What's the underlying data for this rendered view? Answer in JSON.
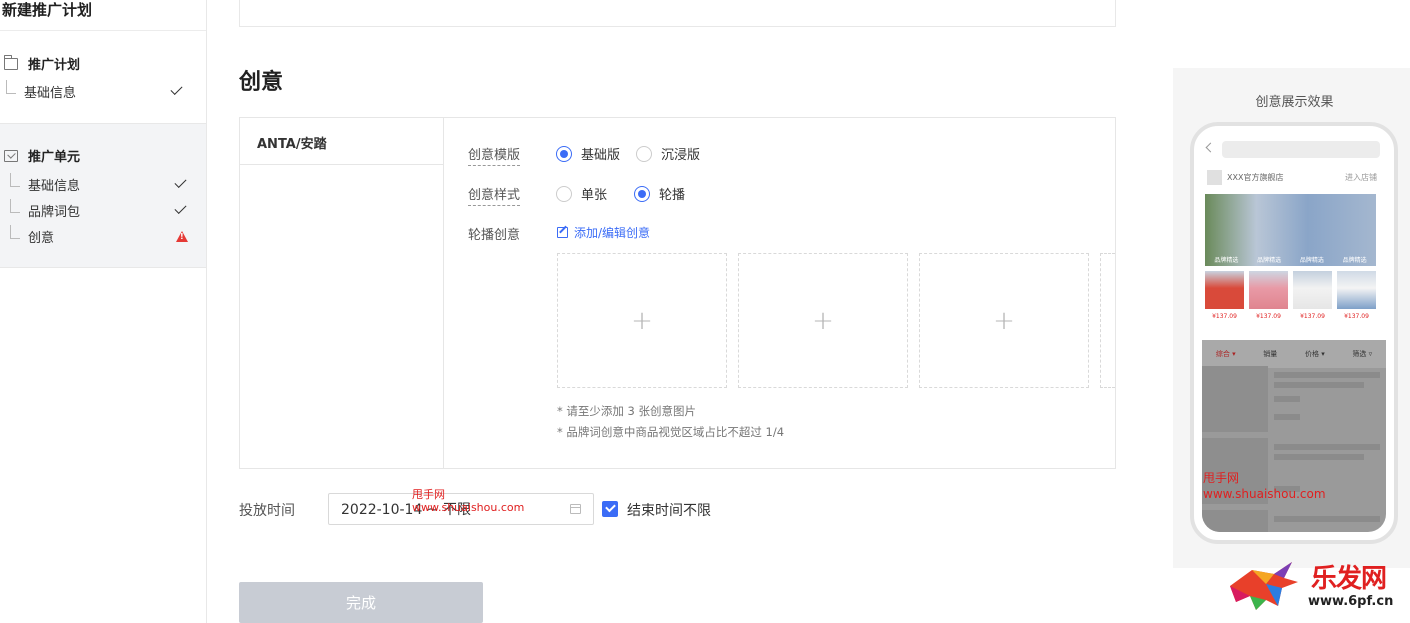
{
  "sidebar": {
    "title": "新建推广计划",
    "group1": {
      "label": "推广计划",
      "items": [
        {
          "label": "基础信息",
          "status": "done"
        }
      ]
    },
    "group2": {
      "label": "推广单元",
      "items": [
        {
          "label": "基础信息",
          "status": "done"
        },
        {
          "label": "品牌词包",
          "status": "done"
        },
        {
          "label": "创意",
          "status": "warning"
        }
      ]
    }
  },
  "main": {
    "section_title": "创意",
    "brand_name": "ANTA/安踏",
    "template_label": "创意模版",
    "template_options": [
      "基础版",
      "沉浸版"
    ],
    "template_selected": "基础版",
    "style_label": "创意样式",
    "style_options": [
      "单张",
      "轮播"
    ],
    "style_selected": "轮播",
    "carousel_label": "轮播创意",
    "add_edit_link": "添加/编辑创意",
    "upload_slot_symbol": "+",
    "hint1": "* 请至少添加 3 张创意图片",
    "hint2": "* 品牌词创意中商品视觉区域占比不超过 1/4",
    "time_label": "投放时间",
    "date_value": "2022-10-14 ~ 不限",
    "end_time_unlimited_label": "结束时间不限",
    "end_time_unlimited_checked": true,
    "done_button": "完成"
  },
  "watermarks": {
    "cn": "甩手网",
    "url": "www.shuaishou.com"
  },
  "preview": {
    "title": "创意展示效果",
    "shop_name": "XXX官方旗舰店",
    "enter_shop": "进入店铺",
    "banner_captions": [
      "品牌精选",
      "品牌精选",
      "品牌精选",
      "品牌精选"
    ],
    "price": "¥137.09",
    "tabs": [
      "综合 ▾",
      "销量",
      "价格 ▾",
      "筛选 ▿"
    ]
  },
  "corner_logo": {
    "name": "乐发网",
    "url": "www.6pf.cn"
  },
  "colors": {
    "accent": "#3b6cf6",
    "warning": "#e53935",
    "disabled_button": "#c8ccd4"
  }
}
